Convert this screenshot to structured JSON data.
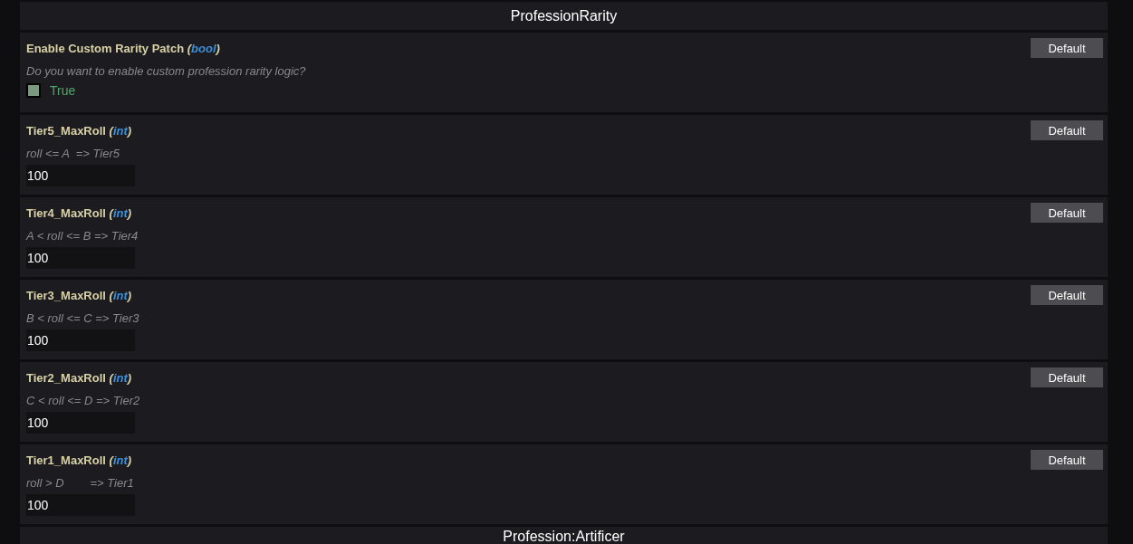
{
  "sections": [
    {
      "title": "ProfessionRarity",
      "settings": [
        {
          "kind": "bool",
          "name": "Enable Custom Rarity Patch",
          "type": "(*bool*)",
          "description": "Do you want to enable custom profession rarity logic?",
          "checked": true,
          "value": "True",
          "button": "Default"
        },
        {
          "kind": "int",
          "name": "Tier5_MaxRoll",
          "type": "(*int*)",
          "description": "roll <= A  => Tier5",
          "value": "100",
          "button": "Default"
        },
        {
          "kind": "int",
          "name": "Tier4_MaxRoll",
          "type": "(*int*)",
          "description": "A < roll <= B => Tier4",
          "value": "100",
          "button": "Default"
        },
        {
          "kind": "int",
          "name": "Tier3_MaxRoll",
          "type": "(*int*)",
          "description": "B < roll <= C => Tier3",
          "value": "100",
          "button": "Default"
        },
        {
          "kind": "int",
          "name": "Tier2_MaxRoll",
          "type": "(*int*)",
          "description": "C < roll <= D => Tier2",
          "value": "100",
          "button": "Default"
        },
        {
          "kind": "int",
          "name": "Tier1_MaxRoll",
          "type": "(*int*)",
          "description": "roll > D        => Tier1",
          "value": "100",
          "button": "Default"
        }
      ]
    },
    {
      "title": "Profession:Artificer"
    }
  ]
}
